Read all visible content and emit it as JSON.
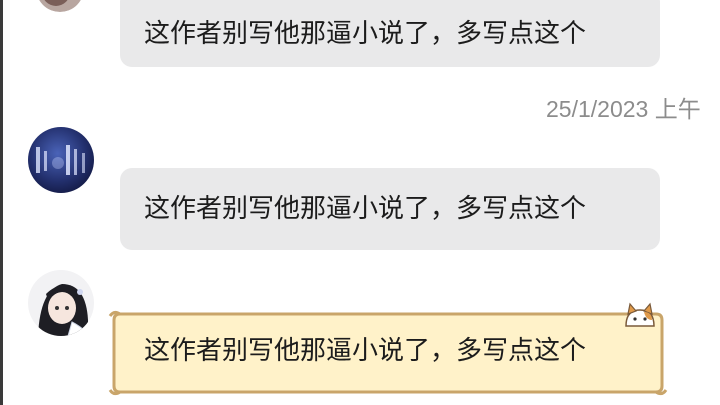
{
  "messages": [
    {
      "text": "这作者别写他那逼小说了，多写点这个",
      "style": "gray"
    },
    {
      "text": "这作者别写他那逼小说了，多写点这个",
      "style": "gray"
    },
    {
      "text": "这作者别写他那逼小说了，多写点这个",
      "style": "fancy-cat"
    }
  ],
  "timestamp": "25/1/2023 上午",
  "colors": {
    "bubble_gray": "#e9e9ea",
    "bubble_fancy": "#fff2c9",
    "bubble_fancy_border": "#c9a56a",
    "timestamp": "#8c8c8c"
  },
  "icons": {
    "avatar_1": "avatar-partial",
    "avatar_2": "avatar-blue-calligraphy",
    "avatar_3": "avatar-anime-girl",
    "bubble_decoration": "cat-icon"
  }
}
